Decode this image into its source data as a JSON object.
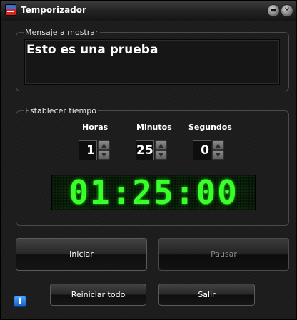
{
  "window": {
    "title": "Temporizador",
    "app_icon": "timer-app-icon",
    "controls": {
      "minimize_glyph": "▬",
      "close_glyph": "✕"
    }
  },
  "message_group": {
    "legend": "Mensaje a mostrar",
    "message_value": "Esto es una prueba"
  },
  "time_group": {
    "legend": "Establecer tiempo",
    "hours": {
      "label": "Horas",
      "value": "1"
    },
    "minutes": {
      "label": "Minutos",
      "value": "25"
    },
    "seconds": {
      "label": "Segundos",
      "value": "0"
    },
    "spinner_up_glyph": "▲",
    "spinner_down_glyph": "▼",
    "display": "01:25:00",
    "display_color": "#39ff2a"
  },
  "buttons": {
    "start": "Iniciar",
    "pause": "Pausar",
    "pause_enabled": false,
    "reset_all": "Reiniciar todo",
    "exit": "Salir"
  },
  "info_glyph": "i"
}
